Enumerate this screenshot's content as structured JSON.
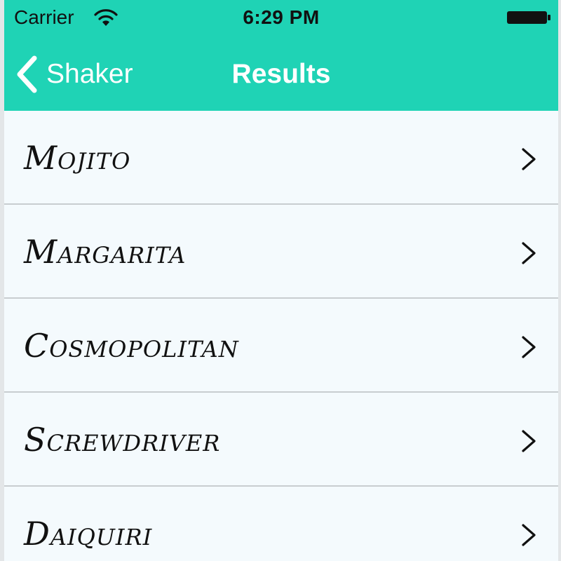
{
  "status_bar": {
    "carrier": "Carrier",
    "time": "6:29 PM"
  },
  "nav": {
    "back_label": "Shaker",
    "title": "Results",
    "background_color": "#1fd3b5"
  },
  "results": [
    {
      "label": "Mojito"
    },
    {
      "label": "Margarita"
    },
    {
      "label": "Cosmopolitan"
    },
    {
      "label": "Screwdriver"
    },
    {
      "label": "Daiquiri"
    }
  ],
  "icons": {
    "status": [
      "wifi-icon",
      "battery-icon"
    ],
    "back": "chevron-left-icon",
    "row_disclosure": "chevron-right-icon"
  }
}
